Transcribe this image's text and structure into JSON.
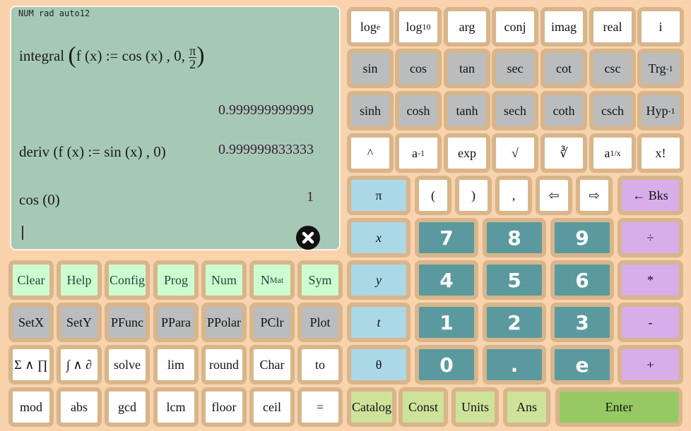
{
  "display": {
    "mode": "NUM rad auto12",
    "entries": [
      {
        "expr_prefix": "integral",
        "expr_body": "f (x) := cos (x) , 0, ",
        "frac_num": "π",
        "frac_den": "2",
        "result": "0.999999999999"
      },
      {
        "expr": "deriv (f (x) := sin (x) , 0)",
        "result": "0.999999833333"
      },
      {
        "expr": "cos (0)",
        "result": "1"
      }
    ],
    "input": "",
    "close_icon": "close-circle-icon"
  },
  "keys": {
    "sci_row1": [
      "log",
      "log",
      "arg",
      "conj",
      "imag",
      "real",
      "i"
    ],
    "sci_row1_subs": [
      "e",
      "10"
    ],
    "trig": [
      "sin",
      "cos",
      "tan",
      "sec",
      "cot",
      "csc",
      "Trg"
    ],
    "hyp": [
      "sinh",
      "cosh",
      "tanh",
      "sech",
      "coth",
      "csch",
      "Hyp"
    ],
    "inv_sup": "-1",
    "pow_row": {
      "caret": "^",
      "recip_base": "a",
      "recip_sup": "-1",
      "exp": "exp",
      "sqrt": "√",
      "cbrt": "∛",
      "root_base": "a",
      "root_sup": "1/x",
      "fact": "x!"
    },
    "sym_row": {
      "pi": "π",
      "lparen": "(",
      "rparen": ")",
      "comma": ",",
      "left": "⇦",
      "right": "⇨",
      "backspace": "← Bks"
    },
    "vars": [
      "x",
      "y",
      "t",
      "θ"
    ],
    "digits": [
      [
        "7",
        "8",
        "9"
      ],
      [
        "4",
        "5",
        "6"
      ],
      [
        "1",
        "2",
        "3"
      ],
      [
        "0",
        ".",
        "e"
      ]
    ],
    "ops": [
      "÷",
      "*",
      "-",
      "+"
    ],
    "bottom": [
      "Catalog",
      "Const",
      "Units",
      "Ans"
    ],
    "enter": "Enter",
    "mode_row": [
      "Clear",
      "Help",
      "Config",
      "Prog",
      "Num",
      "N",
      "Sym"
    ],
    "nmat_sub": "Mat",
    "plot_row": [
      "SetX",
      "SetY",
      "PFunc",
      "PPara",
      "PPolar",
      "PClr",
      "Plot"
    ],
    "calc_row": [
      "Σ ∧ ∏",
      "∫ ∧ ∂",
      "solve",
      "lim",
      "round",
      "Char",
      "to"
    ],
    "misc_row": [
      "mod",
      "abs",
      "gcd",
      "lcm",
      "floor",
      "ceil",
      "="
    ]
  }
}
